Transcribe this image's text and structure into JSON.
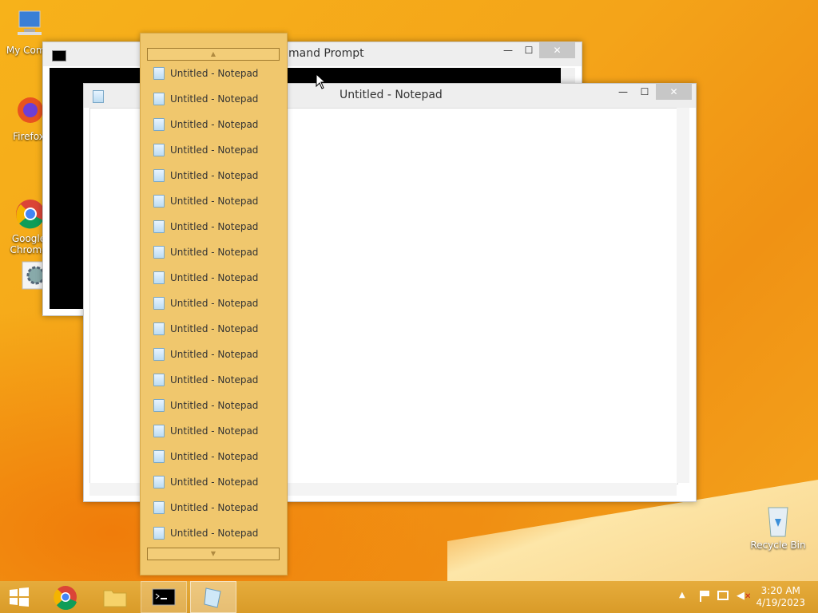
{
  "desktop": {
    "icons": [
      {
        "label": "My Comp"
      },
      {
        "label": "Firefox"
      },
      {
        "label": "Google\nChrome"
      },
      {
        "label": ""
      },
      {
        "label": "Recycle Bin"
      }
    ]
  },
  "cmd_window": {
    "title": "mand Prompt"
  },
  "notepad_window": {
    "title": "Untitled - Notepad"
  },
  "jumplist": {
    "items": [
      "Untitled - Notepad",
      "Untitled - Notepad",
      "Untitled - Notepad",
      "Untitled - Notepad",
      "Untitled - Notepad",
      "Untitled - Notepad",
      "Untitled - Notepad",
      "Untitled - Notepad",
      "Untitled - Notepad",
      "Untitled - Notepad",
      "Untitled - Notepad",
      "Untitled - Notepad",
      "Untitled - Notepad",
      "Untitled - Notepad",
      "Untitled - Notepad",
      "Untitled - Notepad",
      "Untitled - Notepad",
      "Untitled - Notepad",
      "Untitled - Notepad"
    ]
  },
  "window_buttons": {
    "minimize": "—",
    "maximize": "☐",
    "close": "✕"
  },
  "tray": {
    "time": "3:20 AM",
    "date": "4/19/2023"
  },
  "colors": {
    "accent": "#f0c76d",
    "taskbar": "#d99b28"
  }
}
